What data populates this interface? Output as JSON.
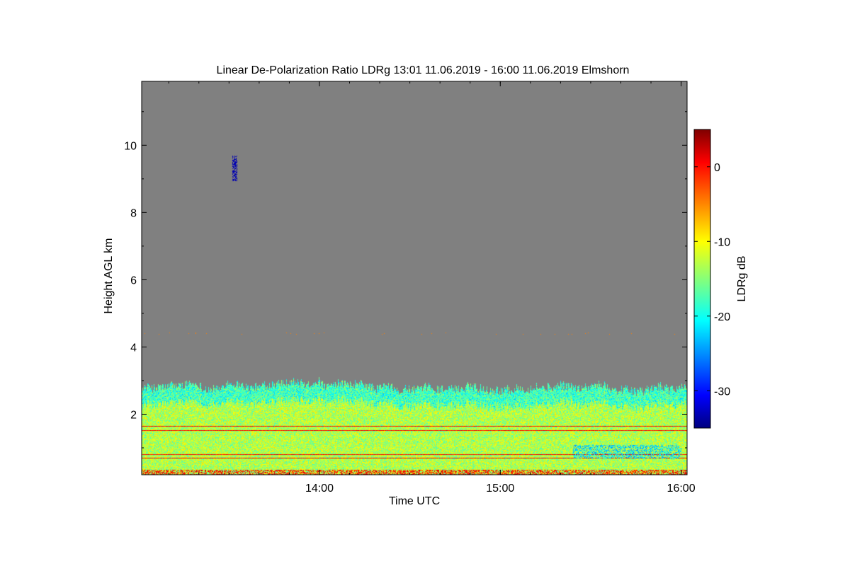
{
  "chart_data": {
    "type": "heatmap",
    "title": "Linear De-Polarization Ratio LDRg   13:01 11.06.2019 - 16:00 11.06.2019 Elmshorn",
    "xlabel": "Time UTC",
    "ylabel": "Height AGL km",
    "xlim_hours": [
      13.017,
      16.033
    ],
    "ylim_km": [
      0.2,
      11.9
    ],
    "x_ticks": [
      {
        "value": 14,
        "label": "14:00"
      },
      {
        "value": 15,
        "label": "15:00"
      },
      {
        "value": 16,
        "label": "16:00"
      }
    ],
    "y_ticks": [
      {
        "value": 2,
        "label": "2"
      },
      {
        "value": 4,
        "label": "4"
      },
      {
        "value": 6,
        "label": "6"
      },
      {
        "value": 8,
        "label": "8"
      },
      {
        "value": 10,
        "label": "10"
      }
    ],
    "no_data_color": "#808080",
    "colorbar": {
      "label": "LDRg dB",
      "range_db": [
        -35,
        5
      ],
      "ticks": [
        {
          "value": 0,
          "label": "0"
        },
        {
          "value": -10,
          "label": "-10"
        },
        {
          "value": -20,
          "label": "-20"
        },
        {
          "value": -30,
          "label": "-30"
        }
      ],
      "colormap": "jet"
    },
    "regions": {
      "boundary_layer_top_km": 2.8,
      "boundary_layer_typical_db": -13,
      "isolated_feature": {
        "time_hours": 13.53,
        "height_km": [
          8.95,
          9.7
        ],
        "value_db": -33
      },
      "layer_near_4_4_km": {
        "height_km": 4.4,
        "value_db": -5
      },
      "low_depolarization_patch": {
        "time_hours": [
          15.4,
          16.0
        ],
        "height_km": [
          0.7,
          1.1
        ],
        "value_db": -22
      }
    }
  }
}
